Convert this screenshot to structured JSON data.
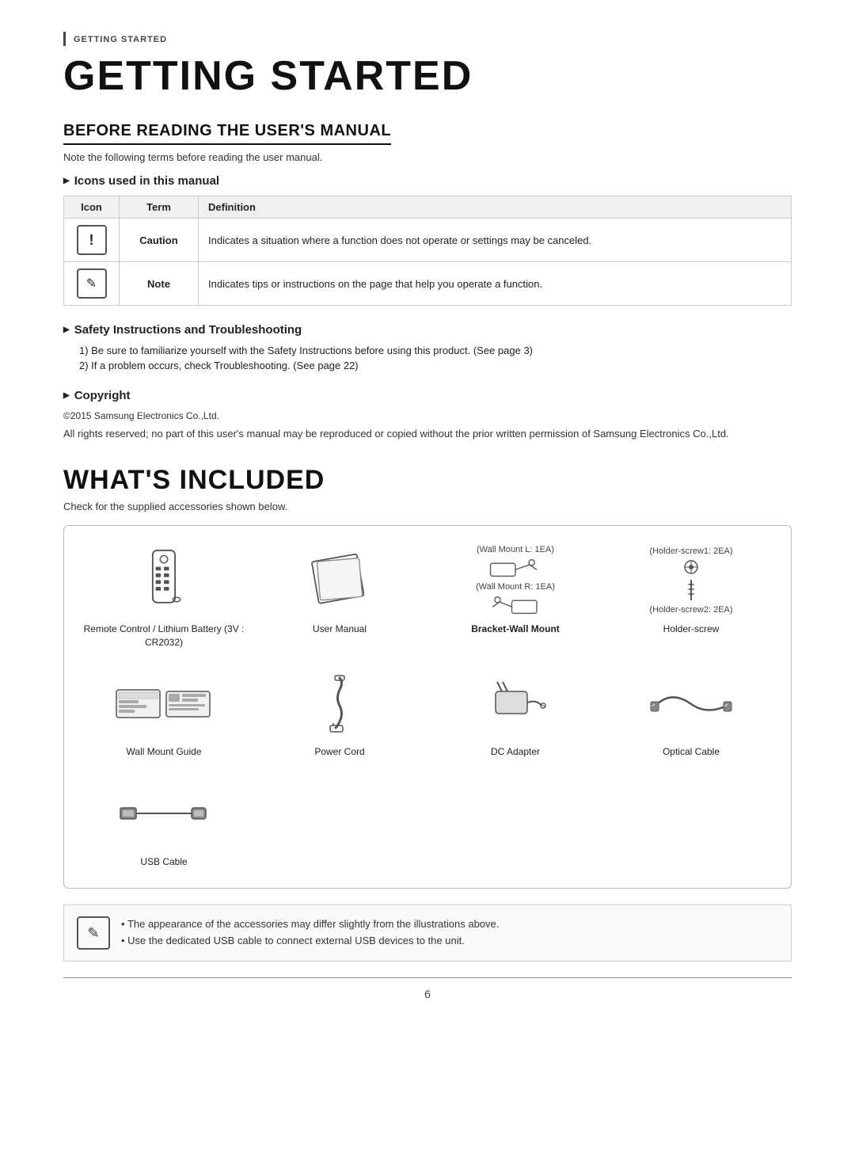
{
  "breadcrumb": "Getting Started",
  "page_title": "GETTING STARTED",
  "before_reading": {
    "title": "BEFORE READING THE USER'S MANUAL",
    "note": "Note the following terms before reading the user manual.",
    "icons_section": {
      "title": "Icons used in this manual",
      "table_headers": [
        "Icon",
        "Term",
        "Definition"
      ],
      "rows": [
        {
          "icon_type": "caution",
          "term": "Caution",
          "definition": "Indicates a situation where a function does not operate or settings may be canceled."
        },
        {
          "icon_type": "note",
          "term": "Note",
          "definition": "Indicates tips or instructions on the page that help you operate a function."
        }
      ]
    },
    "safety_section": {
      "title": "Safety Instructions and Troubleshooting",
      "items": [
        {
          "num": "1",
          "text": "Be sure to familiarize yourself with the Safety Instructions before using this product. (See page 3)"
        },
        {
          "num": "2",
          "text": "If a problem occurs, check Troubleshooting. (See page 22)"
        }
      ]
    },
    "copyright_section": {
      "title": "Copyright",
      "year_text": "©2015 Samsung Electronics Co.,Ltd.",
      "body_text": "All rights reserved; no part of this user's manual may be reproduced or copied without the prior written permission of Samsung Electronics Co.,Ltd."
    }
  },
  "whats_included": {
    "title": "WHAT'S INCLUDED",
    "note": "Check for the supplied accessories shown below.",
    "accessories": [
      {
        "id": "remote",
        "label": "Remote Control / Lithium\nBattery (3V : CR2032)",
        "bold": false
      },
      {
        "id": "manual",
        "label": "User Manual",
        "bold": false
      },
      {
        "id": "bracket",
        "label": "Bracket-Wall Mount",
        "bold": true,
        "sublabels": [
          "(Wall Mount L: 1EA)",
          "(Wall Mount R: 1EA)"
        ]
      },
      {
        "id": "holder",
        "label": "Holder-screw",
        "bold": false,
        "sublabels": [
          "(Holder-screw1: 2EA)",
          "(Holder-screw2: 2EA)"
        ]
      },
      {
        "id": "guide",
        "label": "Wall Mount Guide",
        "bold": false
      },
      {
        "id": "cord",
        "label": "Power Cord",
        "bold": false
      },
      {
        "id": "adapter",
        "label": "DC Adapter",
        "bold": false
      },
      {
        "id": "optical",
        "label": "Optical Cable",
        "bold": false
      },
      {
        "id": "usb",
        "label": "USB Cable",
        "bold": false
      }
    ],
    "notes": [
      "The appearance of the accessories may differ slightly from the illustrations above.",
      "Use the dedicated USB cable to connect external USB devices to the unit."
    ]
  },
  "page_number": "6"
}
